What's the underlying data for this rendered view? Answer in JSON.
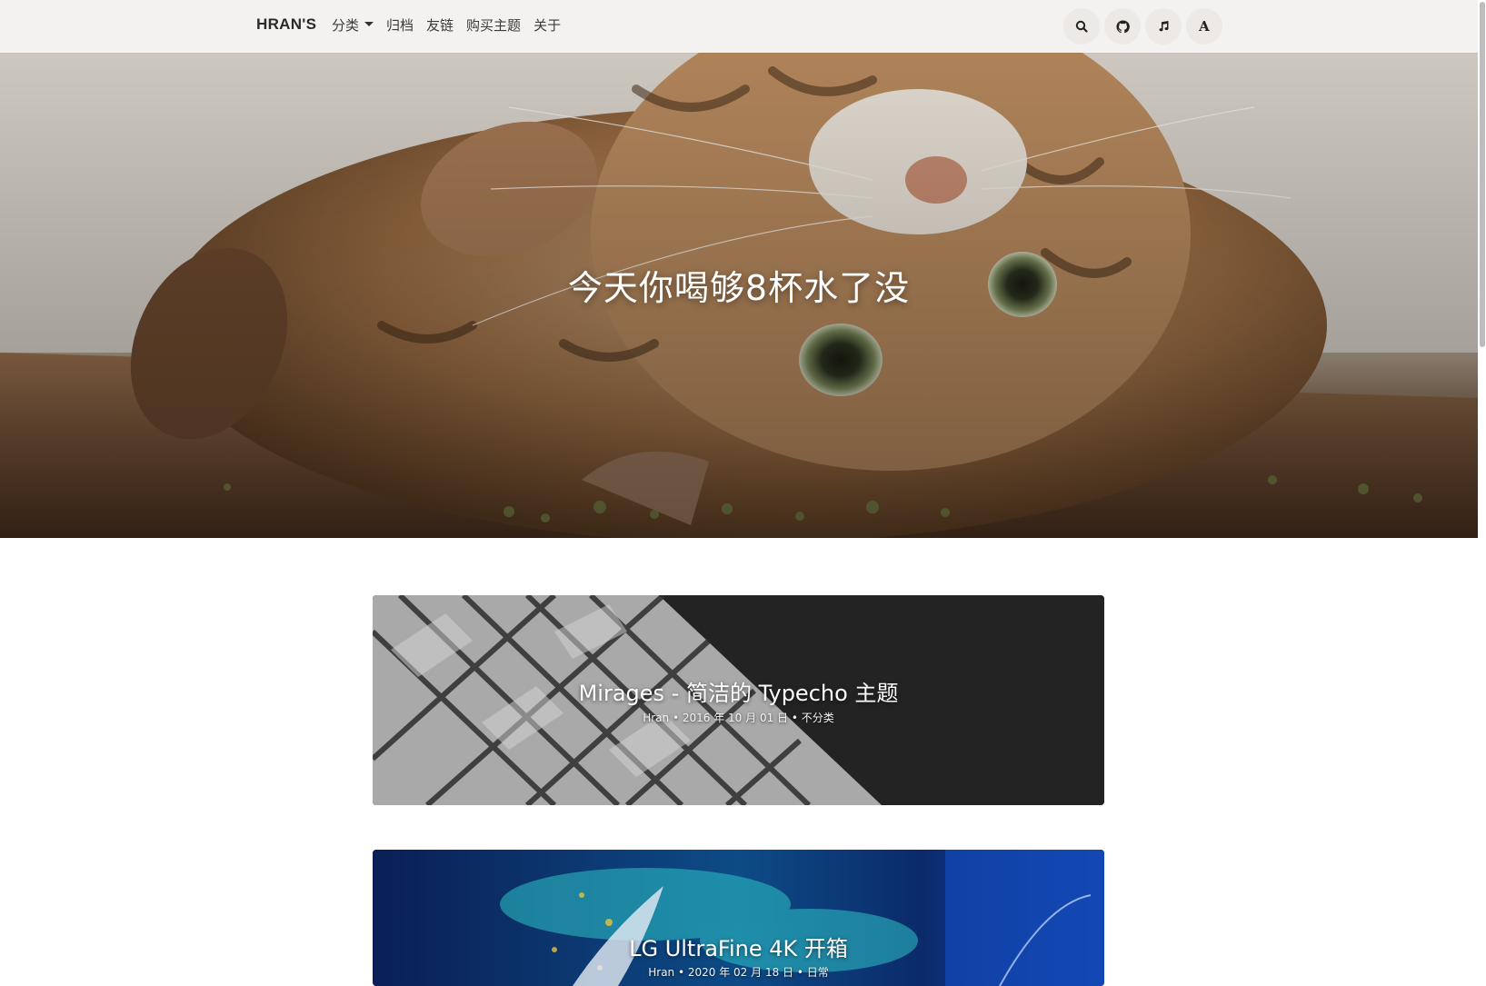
{
  "navbar": {
    "brand": "HRAN'S",
    "links": [
      {
        "label": "分类",
        "has_dropdown": true
      },
      {
        "label": "归档"
      },
      {
        "label": "友链"
      },
      {
        "label": "购买主题"
      },
      {
        "label": "关于"
      }
    ],
    "icons": [
      "search-icon",
      "github-icon",
      "music-icon",
      "font-icon"
    ],
    "font_button_label": "A"
  },
  "hero": {
    "title": "今天你喝够8杯水了没"
  },
  "posts": [
    {
      "title": "Mirages - 简洁的 Typecho 主题",
      "meta": "Hran • 2016 年 10 月 01 日 • 不分类"
    },
    {
      "title": "LG UltraFine 4K 开箱",
      "meta": "Hran • 2020 年 02 月 18 日 • 日常"
    }
  ],
  "colors": {
    "navbar_bg": "#f4f2f0",
    "card_dark": "#232323",
    "card_blue": "#0b2a6a",
    "text_white": "#ffffff"
  }
}
